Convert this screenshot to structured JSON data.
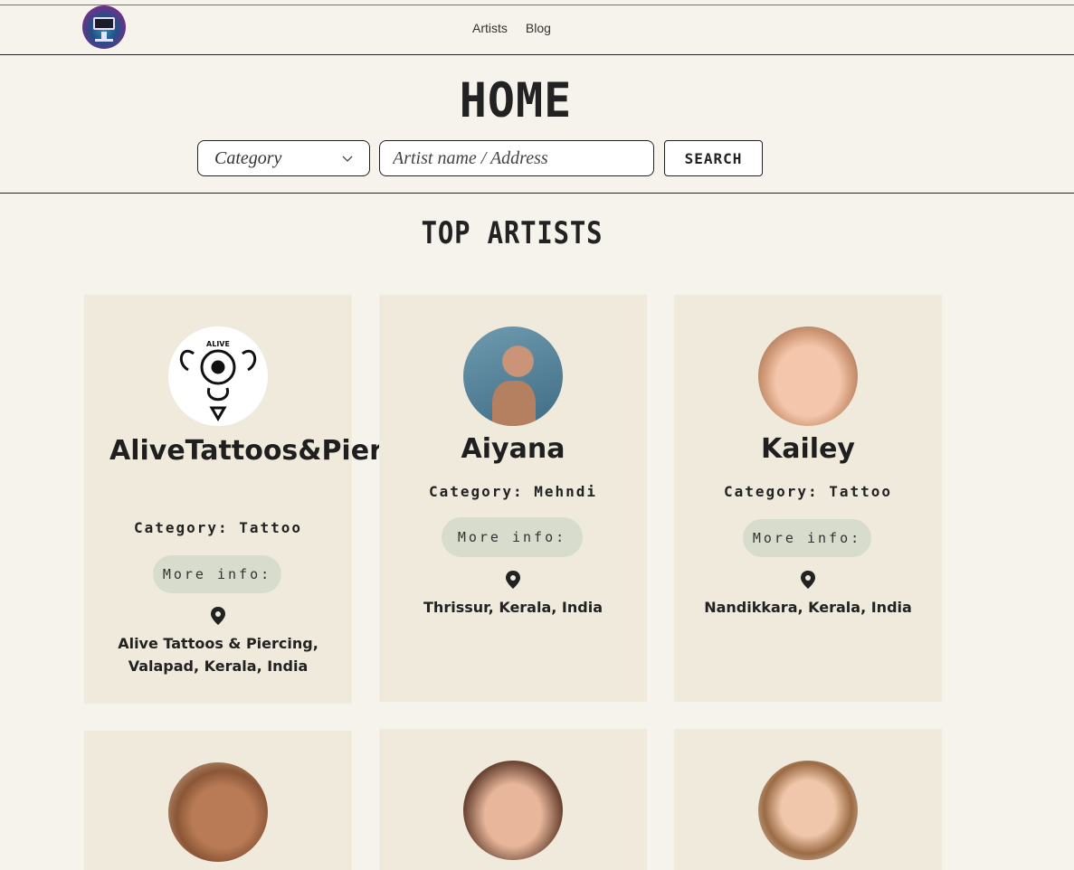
{
  "nav": {
    "items": [
      "Artists",
      "Blog"
    ]
  },
  "hero": {
    "title": "HOME"
  },
  "search": {
    "category_placeholder": "Category",
    "input_placeholder": "Artist name / Address",
    "button_label": "SEARCH"
  },
  "section": {
    "title": "TOP ARTISTS"
  },
  "artists": [
    {
      "name": "AliveTattoos&Piercing",
      "category": "Category: Tattoo",
      "more": "More info:",
      "address": "Alive Tattoos & Piercing, Valapad, Kerala, India",
      "logo_text": "ALIVE"
    },
    {
      "name": "Aiyana",
      "category": "Category: Mehndi",
      "more": "More info:",
      "address": "Thrissur, Kerala, India"
    },
    {
      "name": "Kailey",
      "category": "Category: Tattoo",
      "more": "More info:",
      "address": "Nandikkara, Kerala, India"
    }
  ],
  "colors": {
    "background": "#f6f3ec",
    "card": "#f0eadc",
    "button": "#d7dccd",
    "text": "#1f1f1f"
  },
  "icons": {
    "pin": "location-pin-icon",
    "chevron": "chevron-down-icon",
    "logo": "monitor-logo-icon"
  }
}
